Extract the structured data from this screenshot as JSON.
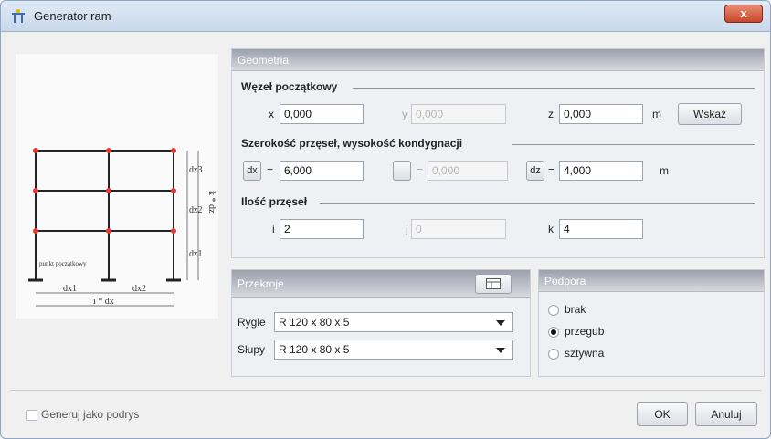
{
  "window": {
    "title": "Generator ram",
    "close_label": "x"
  },
  "geometry": {
    "header": "Geometria",
    "start_node": {
      "label": "Węzeł początkowy",
      "x_label": "x",
      "x_value": "0,000",
      "y_label": "y",
      "y_value": "0,000",
      "z_label": "z",
      "z_value": "0,000",
      "unit": "m",
      "pick_button": "Wskaż"
    },
    "spans": {
      "label": "Szerokość przęseł, wysokość kondygnacji",
      "dx_button": "dx",
      "dx_eq": "=",
      "dx_value": "6,000",
      "dy_eq": "=",
      "dy_value": "0,000",
      "dz_button": "dz",
      "dz_eq": "=",
      "dz_value": "4,000",
      "unit": "m"
    },
    "counts": {
      "label": "Ilość przęseł",
      "i_label": "i",
      "i_value": "2",
      "j_label": "j",
      "j_value": "0",
      "k_label": "k",
      "k_value": "4"
    }
  },
  "sections": {
    "header": "Przekroje",
    "rygle_label": "Rygle",
    "rygle_value": "R 120 x 80 x 5",
    "slupy_label": "Słupy",
    "slupy_value": "R 120 x 80 x 5"
  },
  "support": {
    "header": "Podpora",
    "options": [
      "brak",
      "przegub",
      "sztywna"
    ],
    "selected": "przegub"
  },
  "preview": {
    "dz1": "dz1",
    "dz2": "dz2",
    "dz3": "dz3",
    "kdz": "k * dz",
    "dx1": "dx1",
    "dx2": "dx2",
    "idx": "i * dx",
    "start_point": "punkt\npoczątkowy"
  },
  "footer": {
    "generate_outline": "Generuj jako podrys",
    "ok": "OK",
    "cancel": "Anuluj"
  },
  "colors": {
    "node": "#e53935",
    "header_gradient_top": "#9ba0ac"
  }
}
